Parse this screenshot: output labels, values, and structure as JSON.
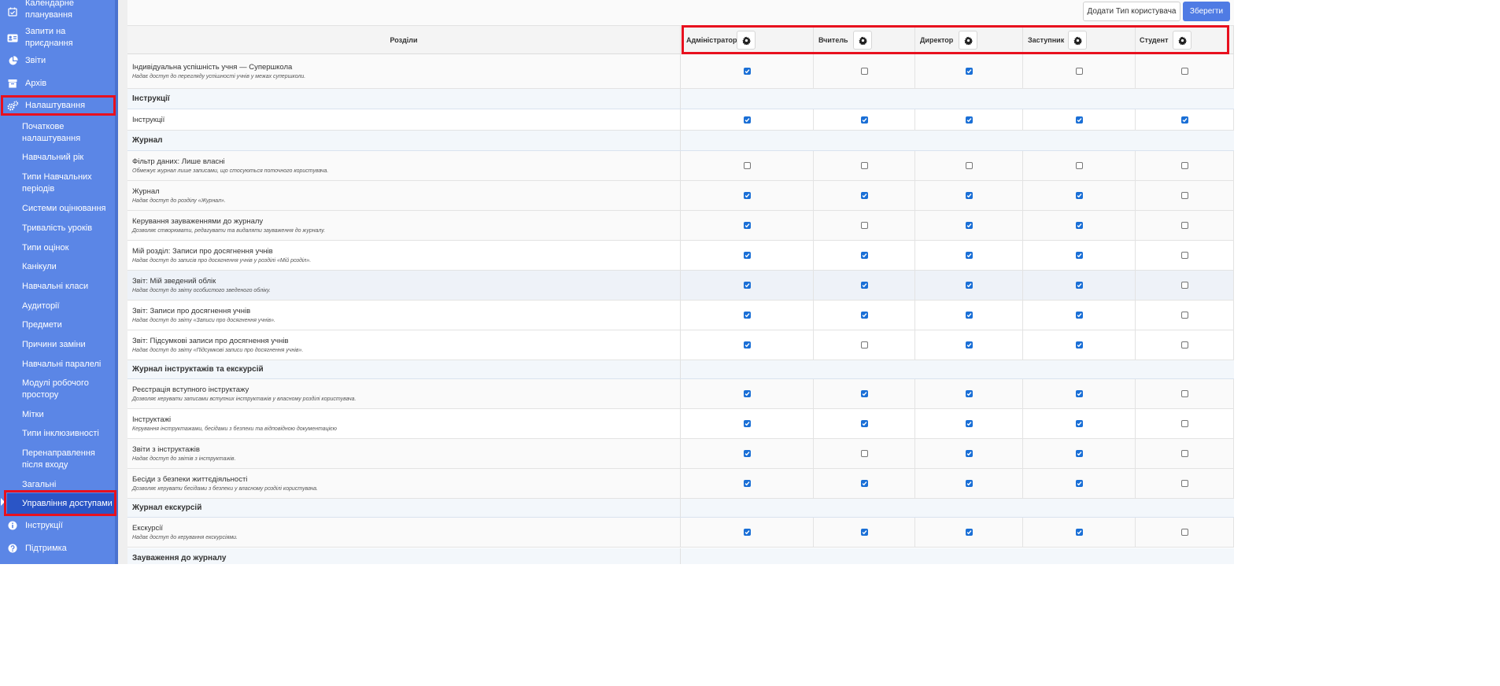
{
  "sidebar": {
    "top_items": [
      {
        "label": "Календарне планування",
        "icon": "calendar-check-icon"
      },
      {
        "label": "Запити на приєднання",
        "icon": "id-card-icon"
      },
      {
        "label": "Звіти",
        "icon": "pie-chart-icon"
      },
      {
        "label": "Архів",
        "icon": "archive-icon"
      },
      {
        "label": "Налаштування",
        "icon": "gears-icon"
      }
    ],
    "settings_items": [
      "Початкове налаштування",
      "Навчальний рік",
      "Типи Навчальних періодів",
      "Системи оцінювання",
      "Тривалість уроків",
      "Типи оцінок",
      "Канікули",
      "Навчальні класи",
      "Аудиторії",
      "Предмети",
      "Причини заміни",
      "Навчальні паралелі",
      "Модулі робочого простору",
      "Мітки",
      "Типи інклюзивності",
      "Перенаправлення після входу",
      "Загальні налаштування",
      "Управління доступами"
    ],
    "bottom_items": [
      {
        "label": "Інструкції",
        "icon": "info-circle-icon"
      },
      {
        "label": "Підтримка",
        "icon": "question-circle-icon"
      }
    ]
  },
  "toolbar": {
    "add_label": "Додати Тип користувача",
    "save_label": "Зберегти"
  },
  "table": {
    "section_header": "Розділи",
    "roles": [
      "Адміністратор",
      "Вчитель",
      "Директор",
      "Заступник",
      "Студент"
    ],
    "rows": [
      {
        "kind": "perm",
        "title": "Індивідуальна успішність учня — Супершкола",
        "desc": "Надає доступ до перегляду успішності учнів у межах супершколи.",
        "checks": [
          true,
          false,
          true,
          false,
          false
        ]
      },
      {
        "kind": "group",
        "title": "Інструкції"
      },
      {
        "kind": "perm",
        "title": "Інструкції",
        "desc": "",
        "checks": [
          true,
          true,
          true,
          true,
          true
        ]
      },
      {
        "kind": "group",
        "title": "Журнал"
      },
      {
        "kind": "perm",
        "title": "Фільтр даних: Лише власні",
        "desc": "Обмежує журнал лише записами, що стосуються поточного користувача.",
        "checks": [
          false,
          false,
          false,
          false,
          false
        ]
      },
      {
        "kind": "perm",
        "title": "Журнал",
        "desc": "Надає доступ до розділу «Журнал».",
        "checks": [
          true,
          true,
          true,
          true,
          false
        ]
      },
      {
        "kind": "perm",
        "title": "Керування зауваженнями до журналу",
        "desc": "Дозволяє створювати, редагувати та видаляти зауваження до журналу.",
        "checks": [
          true,
          false,
          true,
          true,
          false
        ]
      },
      {
        "kind": "perm",
        "title": "Мій розділ: Записи про досягнення учнів",
        "desc": "Надає доступ до записів про досягнення учнів у розділі «Мій розділ».",
        "checks": [
          true,
          true,
          true,
          true,
          false
        ]
      },
      {
        "kind": "perm",
        "title": "Звіт: Мій зведений облік",
        "desc": "Надає доступ до звіту особистого зведеного обліку.",
        "checks": [
          true,
          true,
          true,
          true,
          false
        ]
      },
      {
        "kind": "perm",
        "title": "Звіт: Записи про досягнення учнів",
        "desc": "Надає доступ до звіту «Записи про досягнення учнів».",
        "checks": [
          true,
          true,
          true,
          true,
          false
        ]
      },
      {
        "kind": "perm",
        "title": "Звіт: Підсумкові записи про досягнення учнів",
        "desc": "Надає доступ до звіту «Підсумкові записи про досягнення учнів».",
        "checks": [
          true,
          false,
          true,
          true,
          false
        ]
      },
      {
        "kind": "group",
        "title": "Журнал інструктажів та екскурсій"
      },
      {
        "kind": "perm",
        "title": "Реєстрація вступного інструктажу",
        "desc": "Дозволяє керувати записами вступних інструктажів у власному розділі користувача.",
        "checks": [
          true,
          true,
          true,
          true,
          false
        ]
      },
      {
        "kind": "perm",
        "title": "Інструктажі",
        "desc": "Керування інструктажами, бесідами з безпеки та відповідною документацією",
        "checks": [
          true,
          true,
          true,
          true,
          false
        ]
      },
      {
        "kind": "perm",
        "title": "Звіти з інструктажів",
        "desc": "Надає доступ до звітів з інструктажів.",
        "checks": [
          true,
          false,
          true,
          true,
          false
        ]
      },
      {
        "kind": "perm",
        "title": "Бесіди з безпеки життєдіяльності",
        "desc": "Дозволяє керувати бесідами з безпеки у власному розділі користувача.",
        "checks": [
          true,
          true,
          true,
          true,
          false
        ]
      },
      {
        "kind": "group",
        "title": "Журнал екскурсій"
      },
      {
        "kind": "perm",
        "title": "Екскурсії",
        "desc": "Надає доступ до керування екскурсіями.",
        "checks": [
          true,
          true,
          true,
          true,
          false
        ]
      },
      {
        "kind": "group",
        "title": "Зауваження до журналу"
      }
    ]
  },
  "colors": {
    "sidebar_bg": "#5b86e6",
    "active_item": "#2a55c6",
    "highlight": "#e8101e",
    "checkbox_on": "#1a6fd6",
    "save_button": "#4f7be4"
  }
}
